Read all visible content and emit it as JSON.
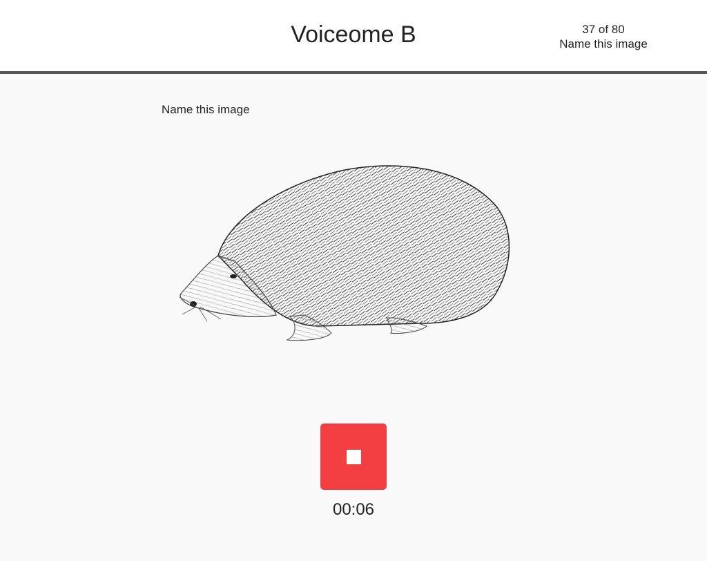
{
  "header": {
    "title": "Voiceome B",
    "progress_count": "37 of 80",
    "progress_task": "Name this image"
  },
  "task": {
    "prompt": "Name this image",
    "stimulus_icon": "hedgehog-illustration"
  },
  "recorder": {
    "stop_icon": "stop-icon",
    "elapsed": "00:06",
    "button_color": "#f43f42"
  }
}
